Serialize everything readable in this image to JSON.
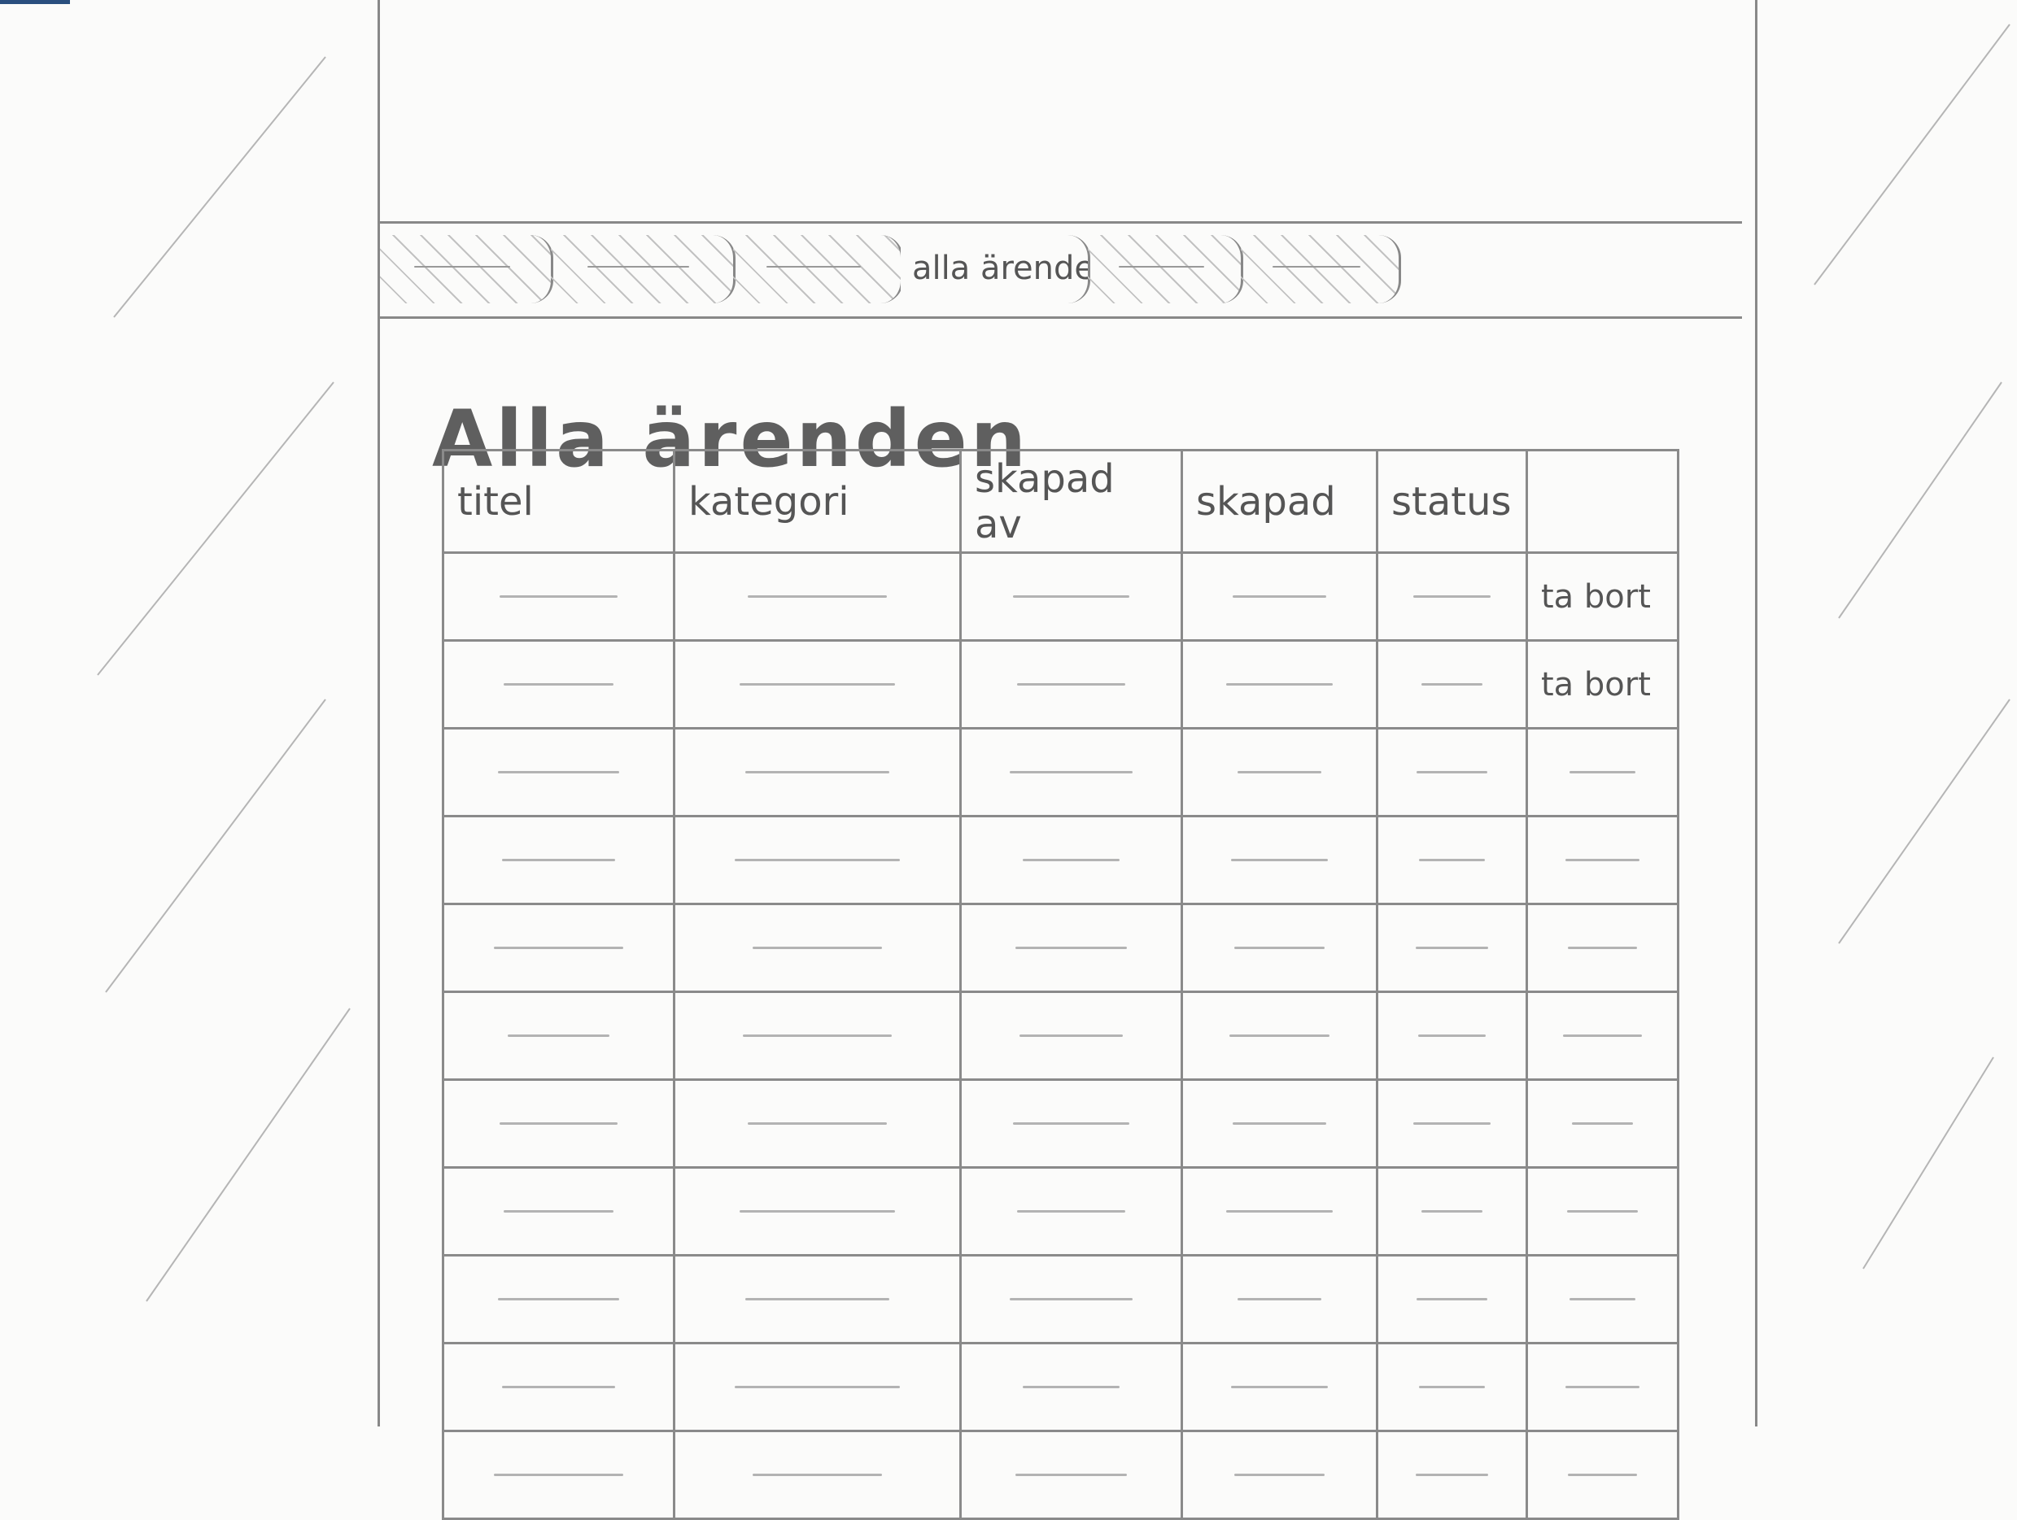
{
  "tabs": [
    {
      "label": "",
      "active": false
    },
    {
      "label": "",
      "active": false
    },
    {
      "label": "",
      "active": false
    },
    {
      "label": "alla ärenden",
      "active": true
    },
    {
      "label": "",
      "active": false
    },
    {
      "label": "",
      "active": false
    }
  ],
  "page_title": "Alla ärenden",
  "table": {
    "columns": [
      "titel",
      "kategori",
      "skapad av",
      "skapad",
      "status",
      ""
    ],
    "remove_label": "ta bort",
    "row_count": 11,
    "rows_with_remove": 2
  }
}
